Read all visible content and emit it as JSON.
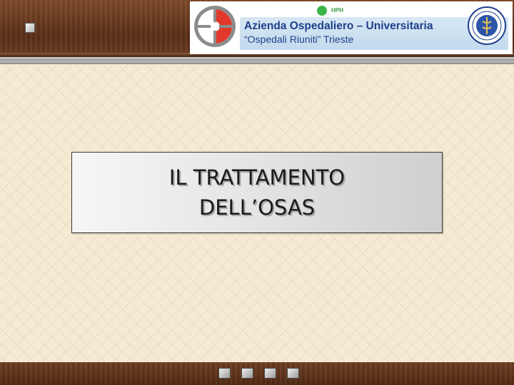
{
  "header": {
    "hph_label": "HPH",
    "org_title": "Azienda Ospedaliero – Universitaria",
    "org_subtitle": "“Ospedali Riuniti” Trieste",
    "colors": {
      "brand_blue": "#1f3f8c",
      "logo_red": "#e2382b",
      "logo_gray": "#8c8c8c",
      "hph_green": "#3bb54a"
    }
  },
  "slide": {
    "title_line_1": "IL TRATTAMENTO",
    "title_line_2": "DELL’OSAS"
  },
  "icons": {
    "corner": "square-icon",
    "nav": [
      "first-slide-icon",
      "previous-slide-icon",
      "next-slide-icon",
      "last-slide-icon"
    ]
  }
}
